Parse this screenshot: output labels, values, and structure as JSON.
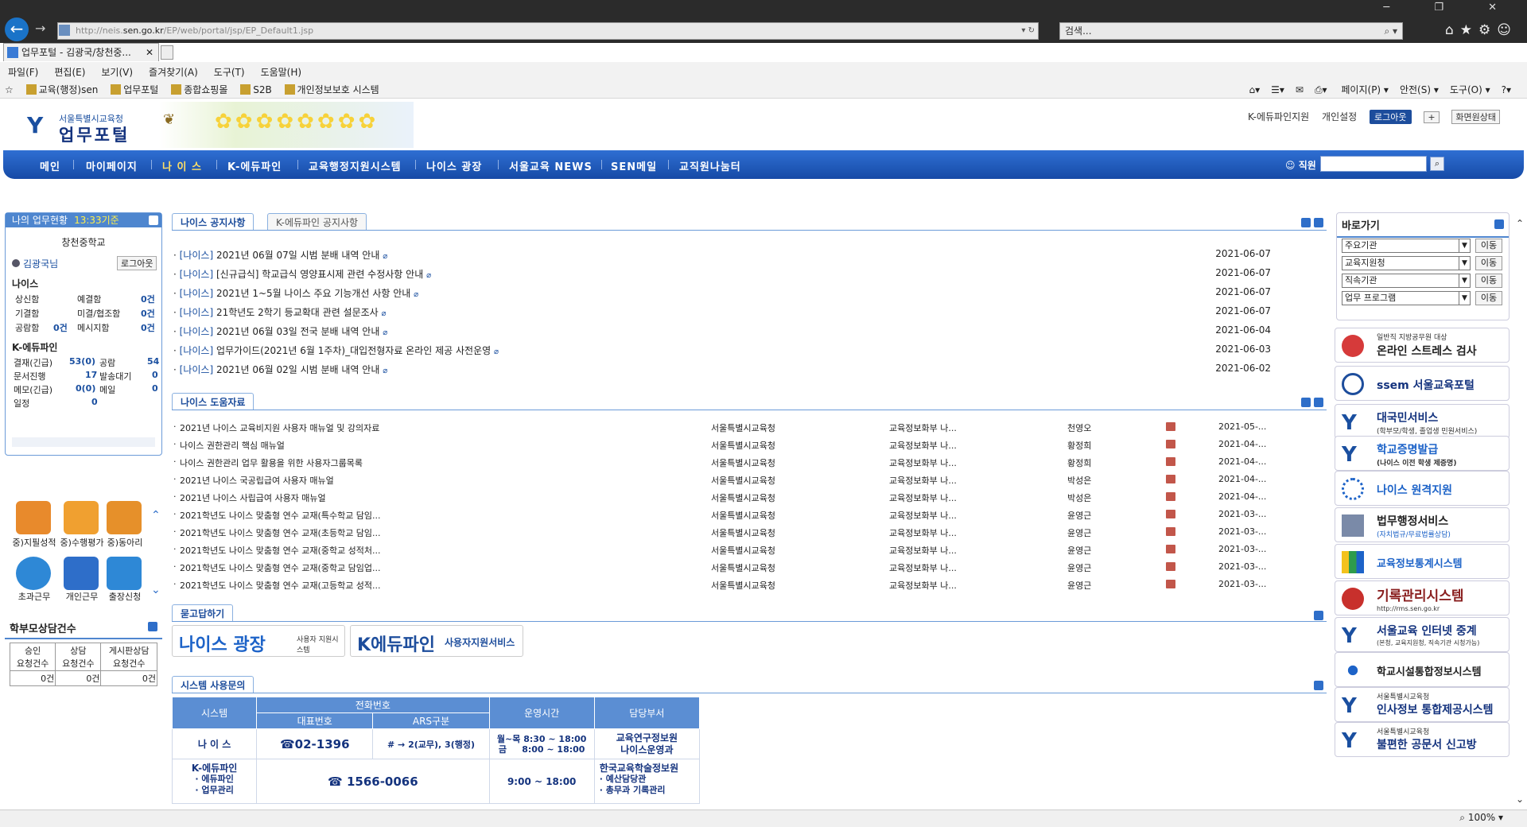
{
  "browser": {
    "url_prefix": "http://neis.",
    "url_host": "sen.go.kr",
    "url_path": "/EP/web/portal/jsp/EP_Default1.jsp",
    "search_placeholder": "검색...",
    "tab_title": "업무포털 - 김광국/창천중...",
    "menu": [
      "파일(F)",
      "편집(E)",
      "보기(V)",
      "즐겨찾기(A)",
      "도구(T)",
      "도움말(H)"
    ],
    "favorites": [
      "교육(행정)sen",
      "업무포털",
      "종합쇼핑몰",
      "S2B",
      "개인정보보호 시스템"
    ],
    "commands": [
      "페이지(P) ▾",
      "안전(S) ▾",
      "도구(O) ▾"
    ],
    "zoom": "100%"
  },
  "portal": {
    "logo_sub": "서울특별시교육청",
    "logo_main": "업무포털",
    "top_links": [
      "K-에듀파인지원",
      "개인설정"
    ],
    "logout_label": "로그아웃",
    "plus_label": "+",
    "screen_label": "화면원상태",
    "nav": [
      "메인",
      "마이페이지",
      "나 이 스",
      "K-에듀파인",
      "교육행정지원시스템",
      "나이스 광장",
      "서울교육 NEWS",
      "SEN메일",
      "교직원나눔터"
    ],
    "nav_active": "나 이 스",
    "staff_label": "직원"
  },
  "mywork": {
    "title": "나의 업무현황",
    "time": "13:33기준",
    "school": "창천중학교",
    "user": "김광국님",
    "logout": "로그아웃",
    "neis_title": "나이스",
    "neis_rows": [
      {
        "a": "상신함",
        "b": "예결함",
        "c": "0건"
      },
      {
        "a": "기결함",
        "b": "미결/협조함",
        "c": "0건"
      },
      {
        "a": "공람함",
        "av": "0건",
        "b": "메시지함",
        "c": "0건"
      }
    ],
    "edufine_title": "K-에듀파인",
    "edufine_rows": [
      {
        "a": "결재(긴급)",
        "av": "53(0)",
        "b": "공람",
        "bv": "54"
      },
      {
        "a": "문서진행",
        "av": "17",
        "b": "발송대기",
        "bv": "0"
      },
      {
        "a": "메모(긴급)",
        "av": "0(0)",
        "b": "메일",
        "bv": "0"
      },
      {
        "a": "일정",
        "av": "0"
      }
    ]
  },
  "quick_icons": [
    "중)지필성적",
    "중)수행평가",
    "중)동아리",
    "초과근무",
    "개인근무",
    "출장신청"
  ],
  "parent": {
    "title": "학부모상담건수",
    "headers": [
      "승인\n요청건수",
      "상담\n요청건수",
      "게시판상담\n요청건수"
    ],
    "values": [
      "0건",
      "0건",
      "0건"
    ]
  },
  "notices": {
    "tabs": [
      "나이스 공지사항",
      "K-에듀파인 공지사항"
    ],
    "rows": [
      {
        "tag": "[나이스]",
        "title": "2021년 06월 07일 시범 분배 내역 안내",
        "date": "2021-06-07"
      },
      {
        "tag": "[나이스]",
        "title": "[신규급식] 학교급식 영양표시제 관련 수정사항 안내",
        "date": "2021-06-07"
      },
      {
        "tag": "[나이스]",
        "title": "2021년 1~5월 나이스 주요 기능개선 사항 안내",
        "date": "2021-06-07"
      },
      {
        "tag": "[나이스]",
        "title": "21학년도 2학기 등교확대 관련 설문조사",
        "date": "2021-06-07"
      },
      {
        "tag": "[나이스]",
        "title": "2021년 06월 03일 전국 분배 내역 안내",
        "date": "2021-06-04"
      },
      {
        "tag": "[나이스]",
        "title": "업무가이드(2021년 6월 1주차)_대입전형자료 온라인 제공 사전운영",
        "date": "2021-06-03"
      },
      {
        "tag": "[나이스]",
        "title": "2021년 06월 02일 시범 분배 내역 안내",
        "date": "2021-06-02"
      }
    ]
  },
  "help": {
    "tab": "나이스 도움자료",
    "rows": [
      {
        "title": "2021년 나이스 교육비지원 사용자 매뉴얼 및 강의자료",
        "org": "서울특별시교육청",
        "dept": "교육정보화부 나...",
        "author": "천영오",
        "date": "2021-05-..."
      },
      {
        "title": "나이스 권한관리 핵심 매뉴얼",
        "org": "서울특별시교육청",
        "dept": "교육정보화부 나...",
        "author": "황정희",
        "date": "2021-04-..."
      },
      {
        "title": "나이스 권한관리 업무 활용을 위한 사용자그룹목록",
        "org": "서울특별시교육청",
        "dept": "교육정보화부 나...",
        "author": "황정희",
        "date": "2021-04-..."
      },
      {
        "title": "2021년 나이스 국공립급여 사용자 매뉴얼",
        "org": "서울특별시교육청",
        "dept": "교육정보화부 나...",
        "author": "박성은",
        "date": "2021-04-..."
      },
      {
        "title": "2021년 나이스 사립급여 사용자 매뉴얼",
        "org": "서울특별시교육청",
        "dept": "교육정보화부 나...",
        "author": "박성은",
        "date": "2021-04-..."
      },
      {
        "title": "2021학년도 나이스 맞춤형 연수 교재(특수학교 담임...",
        "org": "서울특별시교육청",
        "dept": "교육정보화부 나...",
        "author": "윤영근",
        "date": "2021-03-..."
      },
      {
        "title": "2021학년도 나이스 맞춤형 연수 교재(초등학교 담임...",
        "org": "서울특별시교육청",
        "dept": "교육정보화부 나...",
        "author": "윤영근",
        "date": "2021-03-..."
      },
      {
        "title": "2021학년도 나이스 맞춤형 연수 교재(중학교 성적처...",
        "org": "서울특별시교육청",
        "dept": "교육정보화부 나...",
        "author": "윤영근",
        "date": "2021-03-..."
      },
      {
        "title": "2021학년도 나이스 맞춤형 연수 교재(중학교 담임업...",
        "org": "서울특별시교육청",
        "dept": "교육정보화부 나...",
        "author": "윤영근",
        "date": "2021-03-..."
      },
      {
        "title": "2021학년도 나이스 맞춤형 연수 교재(고등학교 성적...",
        "org": "서울특별시교육청",
        "dept": "교육정보화부 나...",
        "author": "윤영근",
        "date": "2021-03-..."
      }
    ]
  },
  "qna": {
    "tab": "묻고답하기",
    "logo1_main": "나이스 광장",
    "logo1_sub": "사용자 지원시스템",
    "logo2_main": "K에듀파인",
    "logo2_sub": "사용자지원서비스"
  },
  "sysinq": {
    "tab": "시스템 사용문의",
    "h_system": "시스템",
    "h_phone": "전화번호",
    "h_main": "대표번호",
    "h_ars": "ARS구분",
    "h_hours": "운영시간",
    "h_dept": "담당부서",
    "r1_system": "나 이 스",
    "r1_phone": "☎02-1396",
    "r1_ars": "# → 2(교무), 3(행정)",
    "r1_hours1": "월~목 8:30 ~ 18:00",
    "r1_hours2": "금     8:00 ~ 18:00",
    "r1_dept1": "교육연구정보원",
    "r1_dept2": "나이스운영과",
    "r2_system": "K-에듀파인",
    "r2_items": [
      "에듀파인",
      "업무관리"
    ],
    "r2_phone": "☎ 1566-0066",
    "r2_hours": "9:00 ~ 18:00",
    "r2_dept": "한국교육학술정보원",
    "r2_dept_items": [
      "예산담당관",
      "총무과 기록관리"
    ]
  },
  "shortcut": {
    "title": "바로가기",
    "selects": [
      "주요기관",
      "교육지원청",
      "직속기관",
      "업무 프로그램"
    ],
    "go_label": "이동"
  },
  "banners": [
    {
      "pre": "일반직 지방공무원 대상",
      "title": "온라인 스트레스 검사",
      "sub": ""
    },
    {
      "pre": "",
      "title": "ssem 서울교육포털",
      "sub": ""
    },
    {
      "pre": "",
      "title": "대국민서비스",
      "sub": "(학부모/학생, 졸업생 민원서비스)"
    },
    {
      "pre": "",
      "title": "학교증명발급",
      "sub": "(나이스 이전 학생 제증명)"
    },
    {
      "pre": "",
      "title": "나이스 원격지원",
      "sub": ""
    },
    {
      "pre": "",
      "title": "법무행정서비스",
      "sub": "(자치법규/무료법률상담)"
    },
    {
      "pre": "",
      "title": "교육정보통계시스템",
      "sub": ""
    },
    {
      "pre": "",
      "title": "기록관리시스템",
      "sub": "http://rms.sen.go.kr"
    },
    {
      "pre": "",
      "title": "서울교육 인터넷 중계",
      "sub": "(본청, 교육지원청, 직속기관 시청가능)"
    },
    {
      "pre": "",
      "title": "학교시설통합정보시스템",
      "sub": ""
    },
    {
      "pre": "서울특별시교육청",
      "title": "인사정보 통합제공시스템",
      "sub": ""
    },
    {
      "pre": "서울특별시교육청",
      "title": "불편한 공문서 신고방",
      "sub": ""
    }
  ]
}
